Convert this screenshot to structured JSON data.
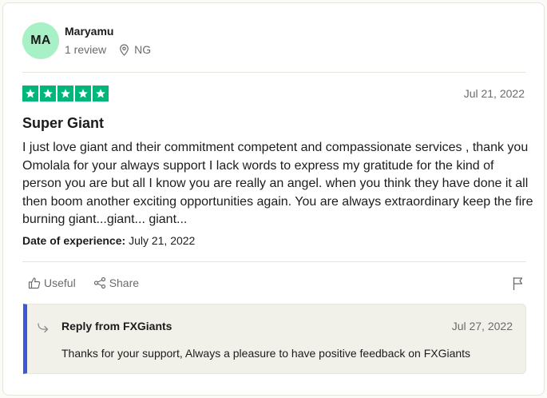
{
  "consumer": {
    "initials": "MA",
    "name": "Maryamu",
    "reviews": "1 review",
    "location": "NG",
    "avatar_color": "#a8f0c6"
  },
  "review": {
    "rating": 5,
    "max_rating": 5,
    "star_color": "#00b67a",
    "date": "Jul 21, 2022",
    "title": "Super Giant",
    "text": "I just love giant and their commitment competent and compassionate services , thank you Omolala for your always support I lack words to express my gratitude for the kind of person you are but all I know you are really an angel. when you think they have done it all then boom another exciting opportunities again. You are always extraordinary keep the fire burning giant...giant... giant...",
    "experience_label": "Date of experience:",
    "experience_date": "July 21, 2022"
  },
  "actions": {
    "useful_label": "Useful",
    "share_label": "Share",
    "icons": [
      "thumbs-up-icon",
      "share-icon",
      "flag-icon"
    ]
  },
  "reply": {
    "title": "Reply from FXGiants",
    "date": "Jul 27, 2022",
    "text": "Thanks for your support, Always a pleasure to have positive feedback on FXGiants",
    "accent_color": "#3c57d8"
  }
}
